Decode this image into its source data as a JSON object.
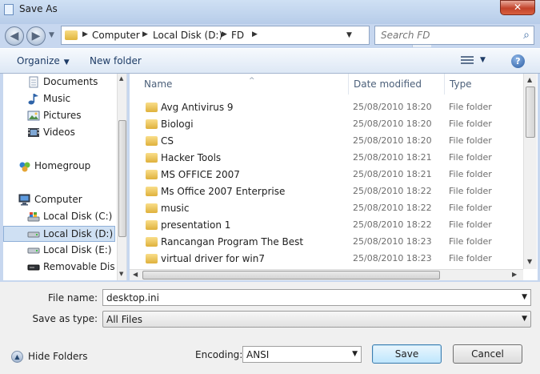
{
  "window": {
    "title": "Save As",
    "close_label": "✕"
  },
  "nav": {
    "back": "◀",
    "forward": "▶",
    "history_dropdown": "▼",
    "breadcrumb": [
      "Computer",
      "Local Disk (D:)",
      "FD"
    ],
    "crumb_sep": "▶",
    "address_dropdown": "▼",
    "refresh": "⇄",
    "search_placeholder": "Search FD",
    "search_icon": "⌕"
  },
  "toolbar": {
    "organize": "Organize",
    "new_folder": "New folder",
    "dropdown": "▼",
    "help": "?"
  },
  "sidebar": {
    "items": [
      {
        "label": "Documents",
        "icon": "documents-icon"
      },
      {
        "label": "Music",
        "icon": "music-icon"
      },
      {
        "label": "Pictures",
        "icon": "pictures-icon"
      },
      {
        "label": "Videos",
        "icon": "videos-icon"
      },
      {
        "label": "Homegroup",
        "icon": "homegroup-icon"
      },
      {
        "label": "Computer",
        "icon": "computer-icon"
      },
      {
        "label": "Local Disk (C:)",
        "icon": "drive-icon"
      },
      {
        "label": "Local Disk (D:)",
        "icon": "drive-icon",
        "selected": true
      },
      {
        "label": "Local Disk (E:)",
        "icon": "drive-icon"
      },
      {
        "label": "Removable Disk (",
        "icon": "removable-drive-icon"
      }
    ]
  },
  "files": {
    "columns": [
      "Name",
      "Date modified",
      "Type"
    ],
    "sort_indicator": "^",
    "rows": [
      {
        "name": "Avg Antivirus 9",
        "date": "25/08/2010 18:20",
        "type": "File folder"
      },
      {
        "name": "Biologi",
        "date": "25/08/2010 18:20",
        "type": "File folder"
      },
      {
        "name": "CS",
        "date": "25/08/2010 18:20",
        "type": "File folder"
      },
      {
        "name": "Hacker Tools",
        "date": "25/08/2010 18:21",
        "type": "File folder"
      },
      {
        "name": "MS OFFICE 2007",
        "date": "25/08/2010 18:21",
        "type": "File folder"
      },
      {
        "name": "Ms Office 2007 Enterprise",
        "date": "25/08/2010 18:22",
        "type": "File folder"
      },
      {
        "name": "music",
        "date": "25/08/2010 18:22",
        "type": "File folder"
      },
      {
        "name": "presentation 1",
        "date": "25/08/2010 18:22",
        "type": "File folder"
      },
      {
        "name": "Rancangan Program The Best",
        "date": "25/08/2010 18:23",
        "type": "File folder"
      },
      {
        "name": "virtual driver for win7",
        "date": "25/08/2010 18:23",
        "type": "File folder"
      }
    ]
  },
  "form": {
    "filename_label": "File name:",
    "filename_value": "desktop.ini",
    "savetype_label": "Save as type:",
    "savetype_value": "All Files",
    "encoding_label": "Encoding:",
    "encoding_value": "ANSI",
    "dropdown": "▼"
  },
  "footer": {
    "hide_folders": "Hide Folders",
    "hide_icon": "▲",
    "save": "Save",
    "cancel": "Cancel"
  },
  "colors": {
    "accent": "#3c7fb1",
    "selection": "#cfe0f3"
  }
}
